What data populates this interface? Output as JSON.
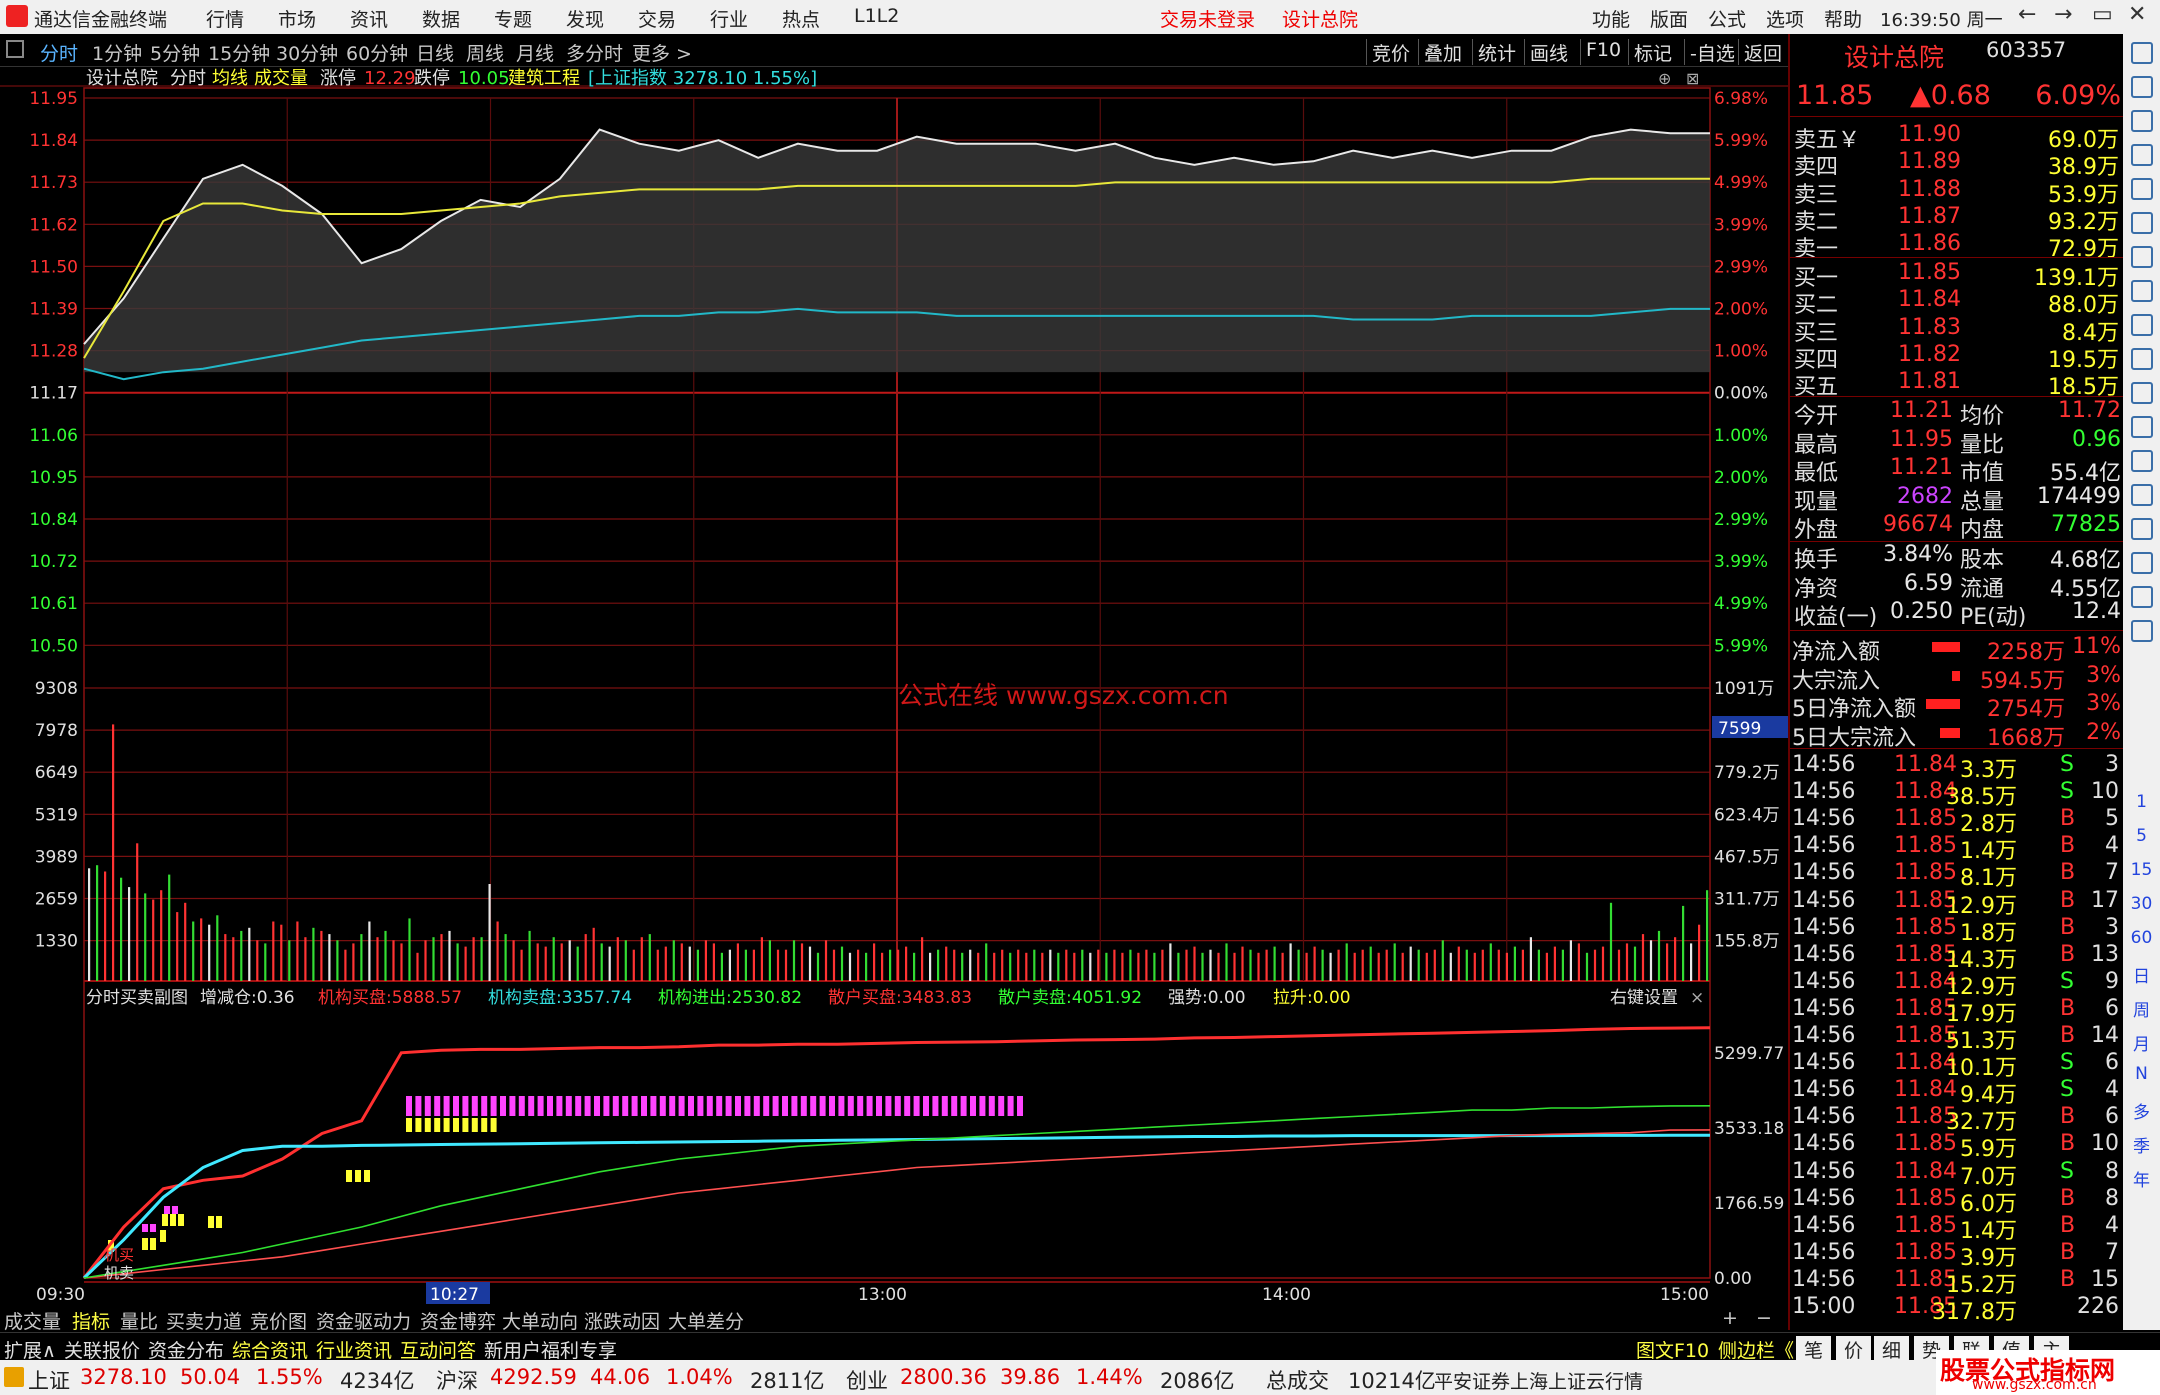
{
  "app": {
    "title": "通达信金融终端",
    "menu": [
      "行情",
      "市场",
      "资讯",
      "数据",
      "专题",
      "发现",
      "交易",
      "行业",
      "热点",
      "L1L2"
    ],
    "notice_trade": "交易未登录",
    "notice_stock": "设计总院",
    "right_menu": [
      "功能",
      "版面",
      "公式",
      "选项",
      "帮助"
    ],
    "clock": "16:39:50 周一",
    "window_buttons": [
      "←",
      "→",
      "▭",
      "✕"
    ]
  },
  "toolbar": {
    "tabs": [
      "分时",
      "1分钟",
      "5分钟",
      "15分钟",
      "30分钟",
      "60分钟",
      "日线",
      "周线",
      "月线",
      "多分时",
      "更多 >"
    ],
    "active_tab": "分时",
    "buttons": [
      "竞价",
      "叠加",
      "统计",
      "画线",
      "F10",
      "标记",
      "-自选",
      "返回"
    ]
  },
  "chart_info": {
    "name": "设计总院",
    "mode": "分时",
    "ma_label": "均线",
    "vol_label": "成交量",
    "limit_up_label": "涨停",
    "limit_up": "12.29",
    "limit_down_label": "跌停",
    "limit_down": "10.05",
    "sector": "建筑工程",
    "index": "[上证指数 3278.10 1.55%]",
    "watermark": "公式在线  www.gszx.com.cn",
    "vol_tag": "7599"
  },
  "price_axis": {
    "left": [
      "11.95",
      "11.84",
      "11.73",
      "11.62",
      "11.50",
      "11.39",
      "11.28",
      "11.17",
      "11.06",
      "10.95",
      "10.84",
      "10.72",
      "10.61",
      "10.50"
    ],
    "right": [
      "6.98%",
      "5.99%",
      "4.99%",
      "3.99%",
      "2.99%",
      "2.00%",
      "1.00%",
      "0.00%",
      "1.00%",
      "2.00%",
      "2.99%",
      "3.99%",
      "4.99%",
      "5.99%"
    ]
  },
  "volume_axis": {
    "left": [
      "9308",
      "7978",
      "6649",
      "5319",
      "3989",
      "2659",
      "1330"
    ],
    "right": [
      "1091万",
      "",
      "779.2万",
      "623.4万",
      "467.5万",
      "311.7万",
      "155.8万"
    ]
  },
  "sub_chart": {
    "title": "分时买卖副图",
    "items": [
      {
        "label": "增减仓:",
        "value": "0.36",
        "color": "#e0e0e0"
      },
      {
        "label": "机构买盘:",
        "value": "5888.57",
        "color": "#ff3333"
      },
      {
        "label": "机构卖盘:",
        "value": "3357.74",
        "color": "#33dddd"
      },
      {
        "label": "机构进出:",
        "value": "2530.82",
        "color": "#33ff33"
      },
      {
        "label": "散户买盘:",
        "value": "3483.83",
        "color": "#ff3333"
      },
      {
        "label": "散户卖盘:",
        "value": "4051.92",
        "color": "#33ff33"
      },
      {
        "label": "强势:",
        "value": "0.00",
        "color": "#e0e0e0"
      },
      {
        "label": "拉升:",
        "value": "0.00",
        "color": "#ffff33"
      }
    ],
    "settings": "右键设置",
    "close": "×",
    "axis": [
      "5299.77",
      "3533.18",
      "1766.59",
      "0.00"
    ],
    "mark_buy": "机买",
    "mark_sell": "机卖"
  },
  "time_axis": [
    "09:30",
    "10:27",
    "13:00",
    "14:00",
    "15:00"
  ],
  "bottom_tabs": [
    "成交量",
    "指标",
    "量比",
    "买卖力道",
    "竞价图",
    "资金驱动力",
    "资金博弈",
    "大单动向",
    "涨跌动因",
    "大单差分"
  ],
  "bottom_tabs_active": "指标",
  "bottom_zoom": [
    "+",
    "−"
  ],
  "bottom_tabs2": [
    "扩展∧",
    "关联报价",
    "资金分布",
    "综合资讯",
    "行业资讯",
    "互动问答",
    "新用户福利专享"
  ],
  "bottom_right": [
    "图文F10",
    "侧边栏《",
    "笔",
    "价",
    "细",
    "势",
    "联",
    "值",
    "主"
  ],
  "quote": {
    "name": "设计总院",
    "code": "603357",
    "price": "11.85",
    "change": "▲0.68",
    "pct": "6.09%",
    "asks": [
      {
        "label": "卖五￥",
        "price": "11.90",
        "vol": "69.0万"
      },
      {
        "label": "卖四",
        "price": "11.89",
        "vol": "38.9万"
      },
      {
        "label": "卖三",
        "price": "11.88",
        "vol": "53.9万"
      },
      {
        "label": "卖二",
        "price": "11.87",
        "vol": "93.2万"
      },
      {
        "label": "卖一",
        "price": "11.86",
        "vol": "72.9万"
      }
    ],
    "bids": [
      {
        "label": "买一",
        "price": "11.85",
        "vol": "139.1万"
      },
      {
        "label": "买二",
        "price": "11.84",
        "vol": "88.0万"
      },
      {
        "label": "买三",
        "price": "11.83",
        "vol": "8.4万"
      },
      {
        "label": "买四",
        "price": "11.82",
        "vol": "19.5万"
      },
      {
        "label": "买五",
        "price": "11.81",
        "vol": "18.5万"
      }
    ],
    "stats": [
      {
        "l1": "今开",
        "v1": "11.21",
        "c1": "#ff3333",
        "l2": "均价",
        "v2": "11.72",
        "c2": "#ff3333"
      },
      {
        "l1": "最高",
        "v1": "11.95",
        "c1": "#ff3333",
        "l2": "量比",
        "v2": "0.96",
        "c2": "#33ff33"
      },
      {
        "l1": "最低",
        "v1": "11.21",
        "c1": "#ff3333",
        "l2": "市值",
        "v2": "55.4亿",
        "c2": "#e8e8e8"
      },
      {
        "l1": "现量",
        "v1": "2682",
        "c1": "#cc44ff",
        "l2": "总量",
        "v2": "174499",
        "c2": "#e8e8e8"
      },
      {
        "l1": "外盘",
        "v1": "96674",
        "c1": "#ff3333",
        "l2": "内盘",
        "v2": "77825",
        "c2": "#33ff33"
      }
    ],
    "stats2": [
      {
        "l1": "换手",
        "v1": "3.84%",
        "l2": "股本",
        "v2": "4.68亿"
      },
      {
        "l1": "净资",
        "v1": "6.59",
        "l2": "流通",
        "v2": "4.55亿"
      },
      {
        "l1": "收益(一)",
        "v1": "0.250",
        "l2": "PE(动)",
        "v2": "12.4"
      }
    ],
    "flows": [
      {
        "label": "净流入额",
        "value": "2258万",
        "pct": "11%",
        "bar": 28
      },
      {
        "label": "大宗流入",
        "value": "594.5万",
        "pct": "3%",
        "bar": 8
      },
      {
        "label": "5日净流入额",
        "value": "2754万",
        "pct": "3%",
        "bar": 34
      },
      {
        "label": "5日大宗流入",
        "value": "1668万",
        "pct": "2%",
        "bar": 20
      }
    ],
    "ticks": [
      {
        "t": "14:56",
        "p": "11.84",
        "v": "3.3万",
        "s": "S",
        "n": "3"
      },
      {
        "t": "14:56",
        "p": "11.84",
        "v": "38.5万",
        "s": "S",
        "n": "10"
      },
      {
        "t": "14:56",
        "p": "11.85",
        "v": "2.8万",
        "s": "B",
        "n": "5"
      },
      {
        "t": "14:56",
        "p": "11.85",
        "v": "1.4万",
        "s": "B",
        "n": "4"
      },
      {
        "t": "14:56",
        "p": "11.85",
        "v": "8.1万",
        "s": "B",
        "n": "7"
      },
      {
        "t": "14:56",
        "p": "11.85",
        "v": "12.9万",
        "s": "B",
        "n": "17"
      },
      {
        "t": "14:56",
        "p": "11.85",
        "v": "1.8万",
        "s": "B",
        "n": "3"
      },
      {
        "t": "14:56",
        "p": "11.85",
        "v": "14.3万",
        "s": "B",
        "n": "13"
      },
      {
        "t": "14:56",
        "p": "11.84",
        "v": "12.9万",
        "s": "S",
        "n": "9"
      },
      {
        "t": "14:56",
        "p": "11.85",
        "v": "17.9万",
        "s": "B",
        "n": "6"
      },
      {
        "t": "14:56",
        "p": "11.85",
        "v": "51.3万",
        "s": "B",
        "n": "14"
      },
      {
        "t": "14:56",
        "p": "11.84",
        "v": "10.1万",
        "s": "S",
        "n": "6"
      },
      {
        "t": "14:56",
        "p": "11.84",
        "v": "9.4万",
        "s": "S",
        "n": "4"
      },
      {
        "t": "14:56",
        "p": "11.85",
        "v": "32.7万",
        "s": "B",
        "n": "6"
      },
      {
        "t": "14:56",
        "p": "11.85",
        "v": "5.9万",
        "s": "B",
        "n": "10"
      },
      {
        "t": "14:56",
        "p": "11.84",
        "v": "7.0万",
        "s": "S",
        "n": "8"
      },
      {
        "t": "14:56",
        "p": "11.85",
        "v": "6.0万",
        "s": "B",
        "n": "8"
      },
      {
        "t": "14:56",
        "p": "11.85",
        "v": "1.4万",
        "s": "B",
        "n": "4"
      },
      {
        "t": "14:56",
        "p": "11.85",
        "v": "3.9万",
        "s": "B",
        "n": "7"
      },
      {
        "t": "14:56",
        "p": "11.85",
        "v": "15.2万",
        "s": "B",
        "n": "15"
      },
      {
        "t": "15:00",
        "p": "11.85",
        "v": "317.8万",
        "s": "",
        "n": "226"
      }
    ]
  },
  "sidebar_text": [
    "1",
    "5",
    "15",
    "30",
    "60",
    "日",
    "周",
    "月",
    "N",
    "多",
    "季",
    "年"
  ],
  "status": {
    "sh_label": "上证",
    "sh": "3278.10",
    "sh_chg": "50.04",
    "sh_pct": "1.55%",
    "sh_amt": "4234亿",
    "hs_label": "沪深",
    "hs": "4292.59",
    "hs_chg": "44.06",
    "hs_pct": "1.04%",
    "hs_amt": "2811亿",
    "cy_label": "创业",
    "cy": "2800.36",
    "cy_chg": "39.86",
    "cy_pct": "1.44%",
    "cy_amt": "2086亿",
    "total_label": "总成交",
    "total": "10214亿",
    "source": "平安证券上海上证云行情",
    "brand": "股票公式指标网",
    "brand_url": "www.gszx.com.cn"
  },
  "chart_data": {
    "type": "line",
    "time_labels": [
      "09:30",
      "10:27",
      "13:00",
      "14:00",
      "15:00"
    ],
    "prev_close": 11.17,
    "ylim": [
      10.4,
      11.95
    ],
    "series": [
      {
        "name": "价格",
        "color": "#e8e8e8",
        "values": [
          11.25,
          11.38,
          11.55,
          11.72,
          11.76,
          11.7,
          11.62,
          11.48,
          11.52,
          11.6,
          11.66,
          11.64,
          11.72,
          11.86,
          11.82,
          11.8,
          11.83,
          11.78,
          11.82,
          11.8,
          11.8,
          11.84,
          11.82,
          11.82,
          11.82,
          11.8,
          11.82,
          11.78,
          11.76,
          11.78,
          11.76,
          11.77,
          11.8,
          11.78,
          11.8,
          11.78,
          11.8,
          11.8,
          11.84,
          11.86,
          11.85,
          11.85
        ]
      },
      {
        "name": "均线",
        "color": "#e8e83a",
        "values": [
          11.21,
          11.4,
          11.6,
          11.65,
          11.65,
          11.63,
          11.62,
          11.62,
          11.62,
          11.63,
          11.64,
          11.65,
          11.67,
          11.68,
          11.69,
          11.69,
          11.69,
          11.69,
          11.7,
          11.7,
          11.7,
          11.7,
          11.7,
          11.7,
          11.7,
          11.7,
          11.71,
          11.71,
          11.71,
          11.71,
          11.71,
          11.71,
          11.71,
          11.71,
          11.71,
          11.71,
          11.71,
          11.71,
          11.72,
          11.72,
          11.72,
          11.72
        ]
      },
      {
        "name": "上证指数",
        "color": "#22b8c8",
        "values": [
          11.18,
          11.15,
          11.17,
          11.18,
          11.2,
          11.22,
          11.24,
          11.26,
          11.27,
          11.28,
          11.29,
          11.3,
          11.31,
          11.32,
          11.33,
          11.33,
          11.34,
          11.34,
          11.35,
          11.34,
          11.34,
          11.34,
          11.33,
          11.33,
          11.33,
          11.33,
          11.33,
          11.33,
          11.33,
          11.33,
          11.33,
          11.33,
          11.32,
          11.32,
          11.32,
          11.33,
          11.33,
          11.33,
          11.33,
          11.34,
          11.35,
          11.35
        ]
      }
    ],
    "volume": {
      "ylim": [
        0,
        9900
      ],
      "values": [
        3600,
        3700,
        3500,
        8200,
        3300,
        3000,
        4400,
        2800,
        2600,
        2900,
        3400,
        2200,
        2500,
        1900,
        2000,
        1800,
        2100,
        1500,
        1400,
        1600,
        1700,
        1300,
        1200,
        1900,
        1800,
        1300,
        1900,
        1400,
        1700,
        1600,
        1500,
        1300,
        1000,
        1200,
        1500,
        1900,
        1400,
        1600,
        1300,
        1200,
        2000,
        900,
        1300,
        1400,
        1500,
        1600,
        1200,
        1100,
        1400,
        1400,
        3100,
        1900,
        1500,
        1300,
        1000,
        1600,
        1200,
        1100,
        1400,
        1200,
        1300,
        1100,
        1500,
        1700,
        1200,
        1100,
        1400,
        1300,
        1000,
        1400,
        1500,
        1000,
        1100,
        1300,
        1200,
        1100,
        1000,
        1300,
        1200,
        900,
        1000,
        1200,
        1000,
        1000,
        1400,
        1300,
        1000,
        1000,
        1300,
        1200,
        1100,
        900,
        1300,
        1000,
        1100,
        900,
        1000,
        900,
        1200,
        900,
        1000,
        1000,
        1100,
        900,
        1400,
        900,
        1000,
        1100,
        1000,
        900,
        1000,
        900,
        1200,
        900,
        1000,
        900,
        1000,
        900,
        1000,
        900,
        1000,
        900,
        1000,
        900,
        1000,
        900,
        1000,
        900,
        1000,
        900,
        1000,
        900,
        1000,
        900,
        1000,
        1200,
        900,
        1000,
        1100,
        900,
        1000,
        900,
        1200,
        900,
        1100,
        1000,
        900,
        1000,
        1100,
        900,
        1200,
        1000,
        900,
        1100,
        1000,
        900,
        1000,
        1200,
        900,
        1000,
        1100,
        900,
        1000,
        1200,
        900,
        1100,
        1000,
        900,
        1000,
        1300,
        900,
        1100,
        1000,
        900,
        1000,
        1200,
        1000,
        900,
        1100,
        1000,
        1400,
        1000,
        900,
        1100,
        1000,
        1300,
        1200,
        900,
        1000,
        1100,
        2500,
        1000,
        1200,
        1100,
        1500,
        1300,
        1600,
        1200,
        1400,
        2400,
        1200,
        1800,
        2900
      ]
    },
    "sub_series": [
      {
        "name": "机构买盘",
        "color": "#ff3030",
        "values": [
          0,
          1200,
          2100,
          2300,
          2400,
          2800,
          3400,
          3700,
          5300,
          5360,
          5380,
          5380,
          5400,
          5420,
          5420,
          5440,
          5480,
          5480,
          5500,
          5500,
          5520,
          5540,
          5550,
          5560,
          5580,
          5600,
          5610,
          5620,
          5650,
          5660,
          5680,
          5700,
          5720,
          5740,
          5760,
          5780,
          5800,
          5820,
          5850,
          5870,
          5880,
          5890
        ]
      },
      {
        "name": "机构卖盘",
        "color": "#40e8ff",
        "values": [
          0,
          900,
          1900,
          2600,
          3000,
          3100,
          3100,
          3120,
          3130,
          3140,
          3150,
          3160,
          3170,
          3180,
          3190,
          3200,
          3210,
          3220,
          3230,
          3240,
          3250,
          3260,
          3270,
          3280,
          3290,
          3300,
          3310,
          3320,
          3330,
          3330,
          3340,
          3340,
          3350,
          3350,
          3350,
          3350,
          3350,
          3350,
          3355,
          3355,
          3357,
          3358
        ]
      },
      {
        "name": "散户买盘",
        "color": "#ff5050",
        "values": [
          0,
          100,
          200,
          300,
          400,
          500,
          650,
          800,
          950,
          1100,
          1250,
          1400,
          1550,
          1700,
          1850,
          2000,
          2100,
          2200,
          2300,
          2400,
          2500,
          2600,
          2650,
          2700,
          2750,
          2800,
          2850,
          2900,
          2950,
          3000,
          3050,
          3100,
          3150,
          3200,
          3250,
          3300,
          3350,
          3380,
          3400,
          3420,
          3480,
          3484
        ]
      },
      {
        "name": "散户卖盘",
        "color": "#30e030",
        "values": [
          0,
          150,
          300,
          450,
          600,
          800,
          1000,
          1200,
          1450,
          1700,
          1900,
          2100,
          2300,
          2500,
          2650,
          2800,
          2900,
          3000,
          3100,
          3150,
          3200,
          3250,
          3300,
          3350,
          3400,
          3450,
          3500,
          3550,
          3600,
          3650,
          3700,
          3750,
          3800,
          3850,
          3900,
          3950,
          3950,
          4000,
          4000,
          4030,
          4050,
          4052
        ]
      }
    ]
  }
}
